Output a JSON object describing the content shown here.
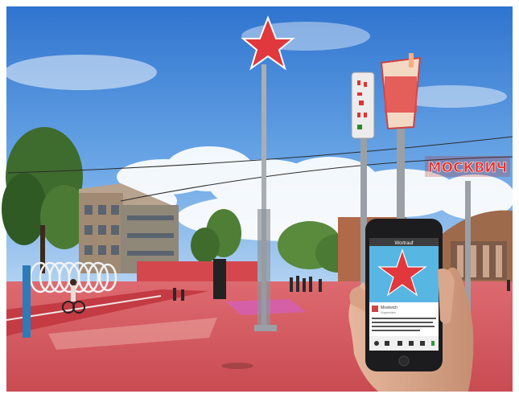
{
  "scene": {
    "neon_sign_text": "МОСКВИЧ",
    "phone_app_title": "Wortrauf",
    "phone_post_user": "Moskvich",
    "phone_post_sub": "Superkilen",
    "phone_caption": "Det røde område ved Superkilen blev indviet i 2012 ..."
  },
  "colors": {
    "sky": "#3f86d9",
    "ground": "#d9525a",
    "star": "#e0383c",
    "phone_screen": "#58b6e3"
  }
}
